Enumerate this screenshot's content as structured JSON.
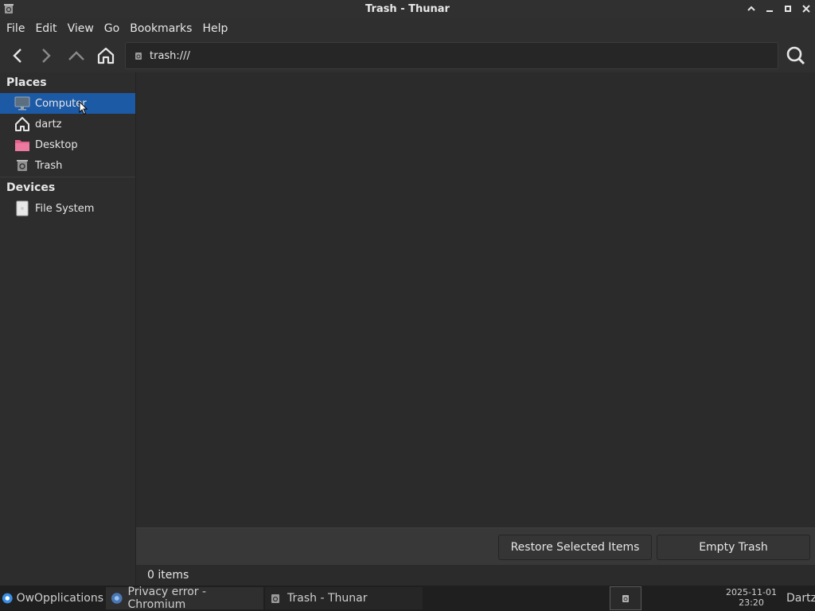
{
  "window": {
    "title": "Trash - Thunar"
  },
  "menu": [
    "File",
    "Edit",
    "View",
    "Go",
    "Bookmarks",
    "Help"
  ],
  "location": {
    "path": "trash:///"
  },
  "sidebar": {
    "places_heading": "Places",
    "places": [
      {
        "label": "Computer",
        "icon": "computer-icon",
        "selected": true
      },
      {
        "label": "dartz",
        "icon": "home-icon"
      },
      {
        "label": "Desktop",
        "icon": "folder-icon"
      },
      {
        "label": "Trash",
        "icon": "trash-icon"
      }
    ],
    "devices_heading": "Devices",
    "devices": [
      {
        "label": "File System",
        "icon": "drive-icon"
      }
    ]
  },
  "trash_actions": {
    "restore_label": "Restore Selected Items",
    "empty_label": "Empty Trash"
  },
  "status": {
    "text": "0 items"
  },
  "taskbar": {
    "apps_label": "OwOpplications",
    "tasks": [
      {
        "label": "Privacy error - Chromium",
        "icon": "chromium-icon"
      },
      {
        "label": "Trash - Thunar",
        "icon": "trash-icon"
      }
    ],
    "clock_date": "2025-11-01",
    "clock_time": "23:20",
    "user": "Dartz"
  },
  "colors": {
    "selection": "#1d5aa6",
    "desktop_folder": "#e0608a"
  }
}
